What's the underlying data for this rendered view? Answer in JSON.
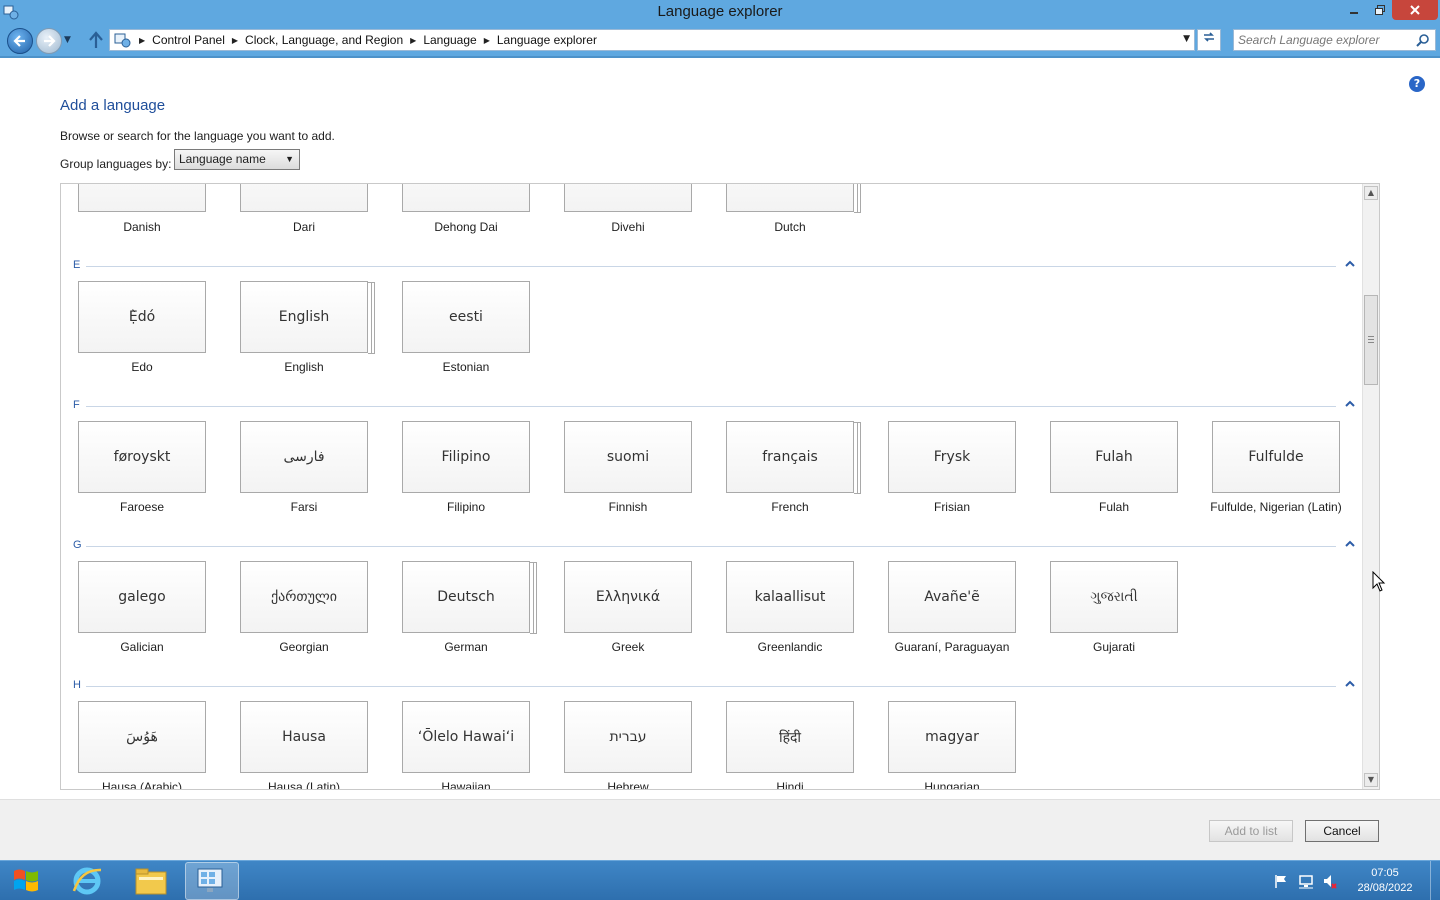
{
  "window": {
    "title": "Language explorer"
  },
  "address": {
    "crumbs": [
      "Control Panel",
      "Clock, Language, and Region",
      "Language",
      "Language explorer"
    ],
    "search_placeholder": "Search Language explorer"
  },
  "page": {
    "heading": "Add a language",
    "instruction": "Browse or search for the language you want to add.",
    "group_label": "Group languages by:",
    "group_value": "Language name"
  },
  "sections": {
    "d_partial": [
      {
        "native": "",
        "caption": "Danish"
      },
      {
        "native": "",
        "caption": "Dari"
      },
      {
        "native": "",
        "caption": "Dehong Dai"
      },
      {
        "native": "",
        "caption": "Divehi"
      },
      {
        "native": "",
        "caption": "Dutch"
      }
    ],
    "e": {
      "letter": "E",
      "items": [
        {
          "native": "Ẹ̀dó",
          "caption": "Edo"
        },
        {
          "native": "English",
          "caption": "English"
        },
        {
          "native": "eesti",
          "caption": "Estonian"
        }
      ]
    },
    "f": {
      "letter": "F",
      "items": [
        {
          "native": "føroyskt",
          "caption": "Faroese"
        },
        {
          "native": "فارسى",
          "caption": "Farsi"
        },
        {
          "native": "Filipino",
          "caption": "Filipino"
        },
        {
          "native": "suomi",
          "caption": "Finnish"
        },
        {
          "native": "français",
          "caption": "French"
        },
        {
          "native": "Frysk",
          "caption": "Frisian"
        },
        {
          "native": "Fulah",
          "caption": "Fulah"
        },
        {
          "native": "Fulfulde",
          "caption": "Fulfulde, Nigerian (Latin)"
        }
      ]
    },
    "g": {
      "letter": "G",
      "items": [
        {
          "native": "galego",
          "caption": "Galician"
        },
        {
          "native": "ქართული",
          "caption": "Georgian"
        },
        {
          "native": "Deutsch",
          "caption": "German"
        },
        {
          "native": "Ελληνικά",
          "caption": "Greek"
        },
        {
          "native": "kalaallisut",
          "caption": "Greenlandic"
        },
        {
          "native": "Avañe'ẽ",
          "caption": "Guaraní, Paraguayan"
        },
        {
          "native": "ગુજરાતી",
          "caption": "Gujarati"
        }
      ]
    },
    "h": {
      "letter": "H",
      "items": [
        {
          "native": "هَوُسَ",
          "caption": "Hausa (Arabic)"
        },
        {
          "native": "Hausa",
          "caption": "Hausa (Latin)"
        },
        {
          "native": "ʻŌlelo Hawaiʻi",
          "caption": "Hawaiian"
        },
        {
          "native": "עברית",
          "caption": "Hebrew"
        },
        {
          "native": "हिंदी",
          "caption": "Hindi"
        },
        {
          "native": "magyar",
          "caption": "Hungarian"
        }
      ]
    }
  },
  "footer": {
    "add_label": "Add to list",
    "cancel_label": "Cancel"
  },
  "taskbar": {
    "time": "07:05",
    "date": "28/08/2022"
  },
  "colors": {
    "titlebar": "#5fa8e0",
    "taskbar": "#3f86c6",
    "link": "#1f4e9a"
  }
}
